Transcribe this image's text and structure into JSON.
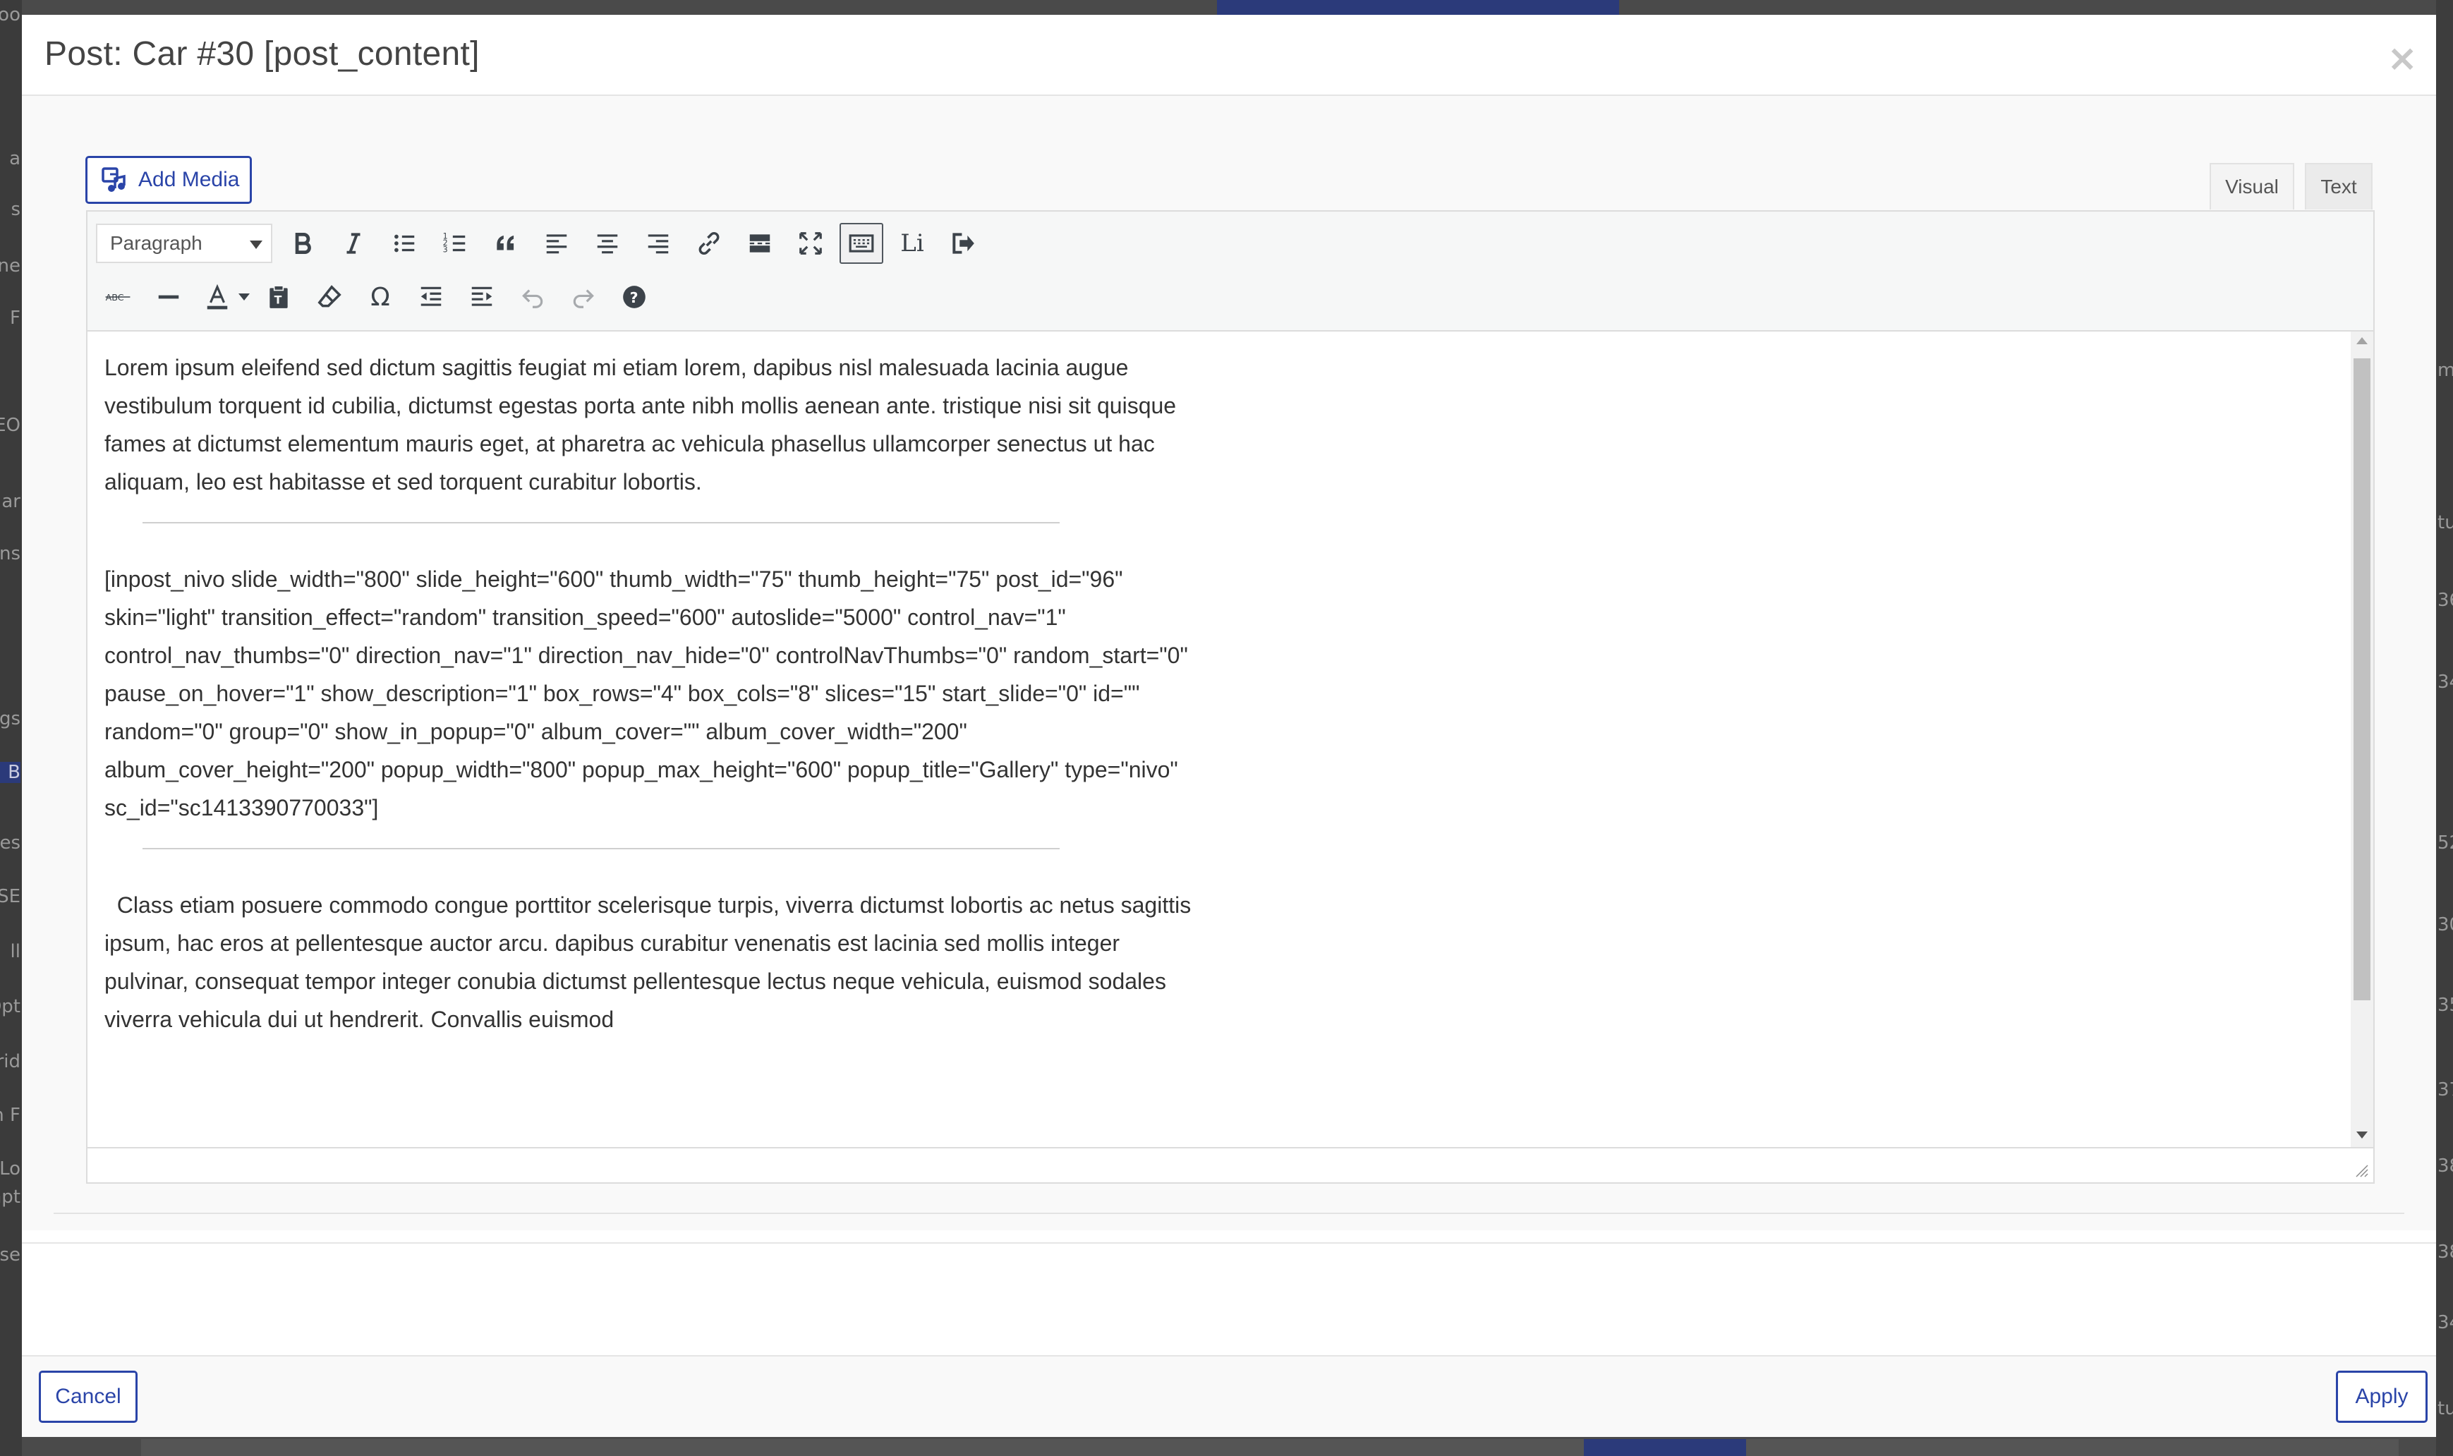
{
  "modal": {
    "title": "Post: Car #30 [post_content]",
    "close_icon": "×"
  },
  "editor": {
    "add_media_label": "Add Media",
    "tabs": [
      "Visual",
      "Text"
    ],
    "active_tab": "Visual",
    "format_select": "Paragraph",
    "toolbar_row1": [
      "bold-icon",
      "italic-icon",
      "bullet-list-icon",
      "numbered-list-icon",
      "blockquote-icon",
      "align-left-icon",
      "align-center-icon",
      "align-right-icon",
      "link-icon",
      "read-more-icon",
      "fullscreen-icon",
      "toolbar-toggle-icon",
      "li-icon",
      "export-icon"
    ],
    "toolbar_row2": [
      "strikethrough-icon",
      "horizontal-line-icon",
      "text-color-icon",
      "paste-text-icon",
      "clear-formatting-icon",
      "special-character-icon",
      "outdent-icon",
      "indent-icon",
      "undo-icon",
      "redo-icon",
      "help-icon"
    ],
    "li_label": "Li",
    "paragraphs": {
      "p1": "Lorem ipsum eleifend sed dictum sagittis feugiat mi etiam lorem, dapibus nisl malesuada lacinia augue vestibulum torquent id cubilia, dictumst egestas porta ante nibh mollis aenean ante. tristique nisi sit quisque fames at dictumst elementum mauris eget, at pharetra ac vehicula phasellus ullamcorper senectus ut hac aliquam, leo est habitasse et sed torquent curabitur lobortis.",
      "p2": "[inpost_nivo slide_width=\"800\" slide_height=\"600\" thumb_width=\"75\" thumb_height=\"75\" post_id=\"96\" skin=\"light\" transition_effect=\"random\" transition_speed=\"600\" autoslide=\"5000\" control_nav=\"1\" control_nav_thumbs=\"0\" direction_nav=\"1\" direction_nav_hide=\"0\" controlNavThumbs=\"0\" random_start=\"0\" pause_on_hover=\"1\" show_description=\"1\" box_rows=\"4\" box_cols=\"8\" slices=\"15\" start_slide=\"0\" id=\"\" random=\"0\" group=\"0\" show_in_popup=\"0\" album_cover=\"\" album_cover_width=\"200\" album_cover_height=\"200\" popup_width=\"800\" popup_max_height=\"600\" popup_title=\"Gallery\" type=\"nivo\" sc_id=\"sc1413390770033\"]",
      "p3": "  Class etiam posuere commodo congue porttitor scelerisque turpis, viverra dictumst lobortis ac netus sagittis ipsum, hac eros at pellentesque auctor arcu. dapibus curabitur venenatis est lacinia sed mollis integer pulvinar, consequat tempor integer conubia dictumst pellentesque lectus neque vehicula, euismod sodales viverra vehicula dui ut hendrerit. Convallis euismod"
    }
  },
  "footer": {
    "cancel_label": "Cancel",
    "apply_label": "Apply"
  },
  "background": {
    "left_fragments": [
      "oo",
      "a",
      "s",
      "ne",
      "F",
      "EO",
      "ar",
      "ns",
      "gs",
      "B",
      "es",
      "SE",
      "ll",
      "Opt",
      "rid",
      "n F",
      "Lo",
      "mpt",
      "se"
    ],
    "right_fragments": [
      "m",
      "tu",
      "36",
      "34",
      "52",
      "30",
      "35",
      "37",
      "38",
      "38",
      "34",
      "tu"
    ]
  },
  "colors": {
    "accent": "#2a44a8",
    "overlay": "#4a4a4a"
  }
}
